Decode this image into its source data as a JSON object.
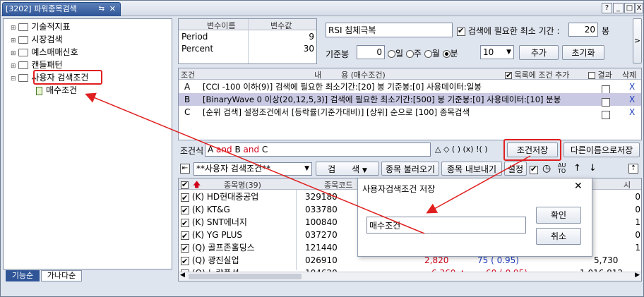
{
  "window": {
    "tab_title": "[3202] 파워종목검색",
    "tab_icon": "⇆",
    "tab_close": "✕",
    "btn_help": "?",
    "btn_min": "_",
    "btn_max": "□",
    "btn_close": "X"
  },
  "tree": {
    "items": [
      "기술적지표",
      "시장검색",
      "예스매매신호",
      "캔들패턴",
      "사용자 검색조건"
    ],
    "child": "매수조건",
    "tabs": [
      "기능순",
      "가나다순"
    ]
  },
  "vars": {
    "header_name": "변수이름",
    "header_value": "변수값",
    "rows": [
      {
        "name": "Period",
        "value": "9"
      },
      {
        "name": "Percent",
        "value": "30"
      }
    ]
  },
  "settings": {
    "condition_name": "RSI 침체극복",
    "min_period_label": "검색에 필요한 최소 기간 :",
    "min_period_value": "20",
    "min_period_unit": "봉",
    "base_label": "기준봉",
    "base_value": "0",
    "radio_day": "일",
    "radio_week": "주",
    "radio_month": "월",
    "radio_min": "분",
    "minute_value": "10",
    "add_button": "추가",
    "reset_button": "초기화",
    "next_arrow": ">"
  },
  "conditions": {
    "header_cond": "조건",
    "header_content": "내        용 (매수조건)",
    "header_add": "목록에 조건 추가",
    "header_result": "결과",
    "header_delete": "삭제",
    "rows": [
      {
        "id": "A",
        "text": "[CCI -100 이하(9)] 검색에 필요한 최소기간:[20] 봉  기준봉:[0] 사용데이터:일봉",
        "delete": "X"
      },
      {
        "id": "B",
        "text": "[BinaryWave 0 이상(20,12,5,3)] 검색에 필요한 최소기간:[500] 봉  기준봉:[0] 사용데이터:[10] 분봉",
        "delete": "X"
      },
      {
        "id": "C",
        "text": "[순위 검색] 설정조건에서 [등락률(기준가대비)] [상위] 순으로 [100] 종목검색",
        "delete": "X"
      }
    ]
  },
  "formula": {
    "label": "조건식",
    "parts": [
      "A",
      "and",
      "B",
      "and",
      "C"
    ],
    "symbols": "△ ◇ ( ) (x) !( )",
    "save_button": "조건저장",
    "save_as_button": "다른이름으로저장"
  },
  "lower_toolbar": {
    "dropdown_value": "**사용자 검색조건**",
    "search_button": "검      색",
    "load_button": "종목 불러오기",
    "export_button": "종목 내보내기",
    "settings_button": "설정"
  },
  "results": {
    "header_name": "종목명(39)",
    "header_code": "종목코드",
    "header_right": "시",
    "rows": [
      {
        "name": "(K) HD현대중공업",
        "code": "329180"
      },
      {
        "name": "(K) KT&G",
        "code": "033780"
      },
      {
        "name": "(K) SNT에너지",
        "code": "100840"
      },
      {
        "name": "(K) YG PLUS",
        "code": "037270"
      },
      {
        "name": "(Q) 골프존홀딩스",
        "code": "121440"
      },
      {
        "name": "(Q) 광진실업",
        "code": "026910",
        "price": "2,820",
        "change": "75 ( 0.95)",
        "volume": "5,730"
      },
      {
        "name": "(Q) 노랑풍선",
        "code": "104620",
        "price": "6,360",
        "change": "60 ( 0.95)",
        "volume": "1,016,812"
      }
    ],
    "right_col_values": [
      "0",
      "0",
      "1",
      "0",
      "1"
    ]
  },
  "dialog": {
    "title": "사용자검색조건 저장",
    "input_value": "매수조건",
    "ok_button": "확인",
    "cancel_button": "취소",
    "close_icon": "✕"
  },
  "colors": {
    "accent_red": "#e02020",
    "selected_row": "#c9c9e3",
    "tab_blue": "#2f5597"
  }
}
